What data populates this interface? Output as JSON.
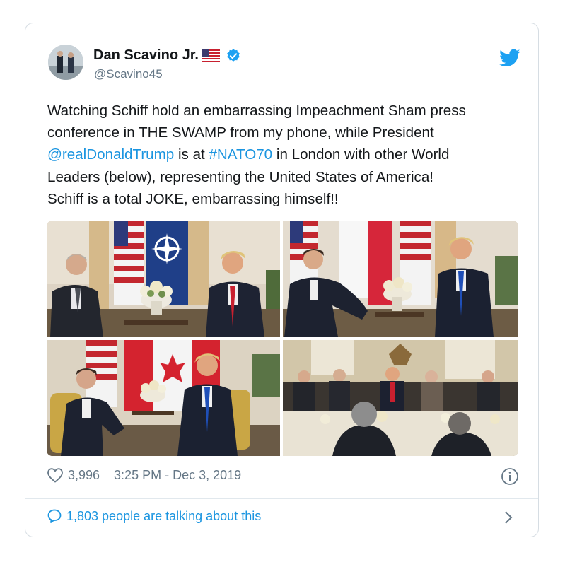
{
  "tweet": {
    "author_name": "Dan Scavino Jr.",
    "handle": "@Scavino45",
    "text_part1": "Watching Schiff hold an embarrassing Impeachment Sham press\nconference in THE SWAMP from my phone, while President\n",
    "mention": "@realDonaldTrump",
    "text_part2": " is at ",
    "hashtag": "#NATO70",
    "text_part3": " in London with other World\nLeaders (below), representing the United States of America!\nSchiff is a total JOKE, embarrassing himself!!",
    "likes": "3,996",
    "timestamp": "3:25 PM - Dec 3, 2019",
    "talking": "1,803 people are talking about this"
  },
  "colors": {
    "link": "#1b95e0",
    "secondary_text": "#657786",
    "border": "#d6dde3",
    "verified": "#1da1f2"
  },
  "icons": {
    "flag": "us-flag-icon",
    "verified": "verified-badge-icon",
    "brand": "twitter-bird-icon",
    "like": "heart-icon",
    "info": "info-icon",
    "reply": "speech-bubble-icon",
    "more": "chevron-right-icon"
  }
}
